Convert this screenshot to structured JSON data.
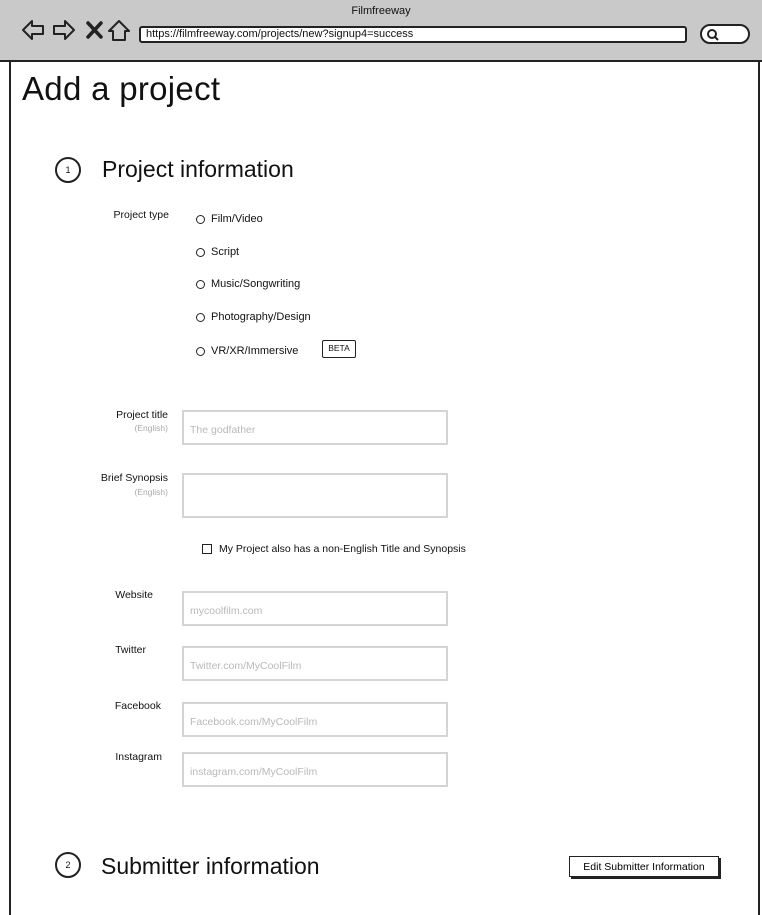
{
  "browser": {
    "window_title": "Filmfreeway",
    "url": "https://filmfreeway.com/projects/new?signup4=success"
  },
  "page": {
    "title": "Add a project"
  },
  "sections": {
    "project_info": {
      "step": "1",
      "heading": "Project information"
    },
    "submitter_info": {
      "step": "2",
      "heading": "Submitter information",
      "edit_button": "Edit Submitter Information"
    }
  },
  "project_type": {
    "label": "Project type",
    "options": [
      "Film/Video",
      "Script",
      "Music/Songwriting",
      "Photography/Design",
      "VR/XR/Immersive"
    ],
    "beta_badge": "BETA"
  },
  "fields": {
    "title": {
      "label": "Project title",
      "sublabel": "(English)",
      "placeholder": "The godfather"
    },
    "synopsis": {
      "label": "Brief Synopsis",
      "sublabel": "(English)",
      "placeholder": ""
    },
    "non_english_checkbox": "My Project also has a non-English Title and Synopsis",
    "website": {
      "label": "Website",
      "placeholder": "mycoolfilm.com"
    },
    "twitter": {
      "label": "Twitter",
      "placeholder": "Twitter.com/MyCoolFilm"
    },
    "facebook": {
      "label": "Facebook",
      "placeholder": "Facebook.com/MyCoolFilm"
    },
    "instagram": {
      "label": "Instagram",
      "placeholder": "instagram.com/MyCoolFilm"
    }
  },
  "icons": {
    "back": "back-arrow-icon",
    "forward": "forward-arrow-icon",
    "close": "close-icon",
    "home": "home-icon",
    "search": "search-icon",
    "step": "step-bubble-icon"
  }
}
